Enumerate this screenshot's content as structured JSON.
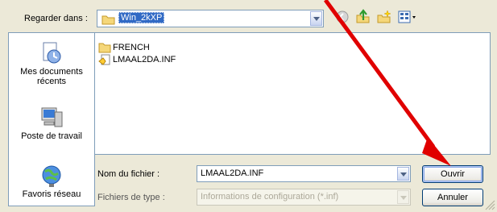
{
  "lookin": {
    "label": "Regarder dans :",
    "value": "Win_2kXP"
  },
  "toolbar": {
    "icons": [
      "back-icon",
      "up-folder-icon",
      "new-folder-icon",
      "views-menu-icon"
    ]
  },
  "places": {
    "items": [
      {
        "label": "Mes documents récents",
        "icon": "recent-documents-icon"
      },
      {
        "label": "Poste de travail",
        "icon": "my-computer-icon"
      },
      {
        "label": "Favoris réseau",
        "icon": "network-places-icon"
      }
    ]
  },
  "files": [
    {
      "name": "FRENCH",
      "icon": "folder-icon"
    },
    {
      "name": "LMAAL2DA.INF",
      "icon": "inf-file-icon"
    }
  ],
  "filename": {
    "label": "Nom du fichier :",
    "value": "LMAAL2DA.INF"
  },
  "filetype": {
    "label": "Fichiers de type :",
    "value": "Informations de configuration (*.inf)"
  },
  "buttons": {
    "open_label": "Ouvrir",
    "cancel_label": "Annuler"
  },
  "colors": {
    "selection": "#316ac5",
    "annotation_arrow": "#e00000"
  }
}
